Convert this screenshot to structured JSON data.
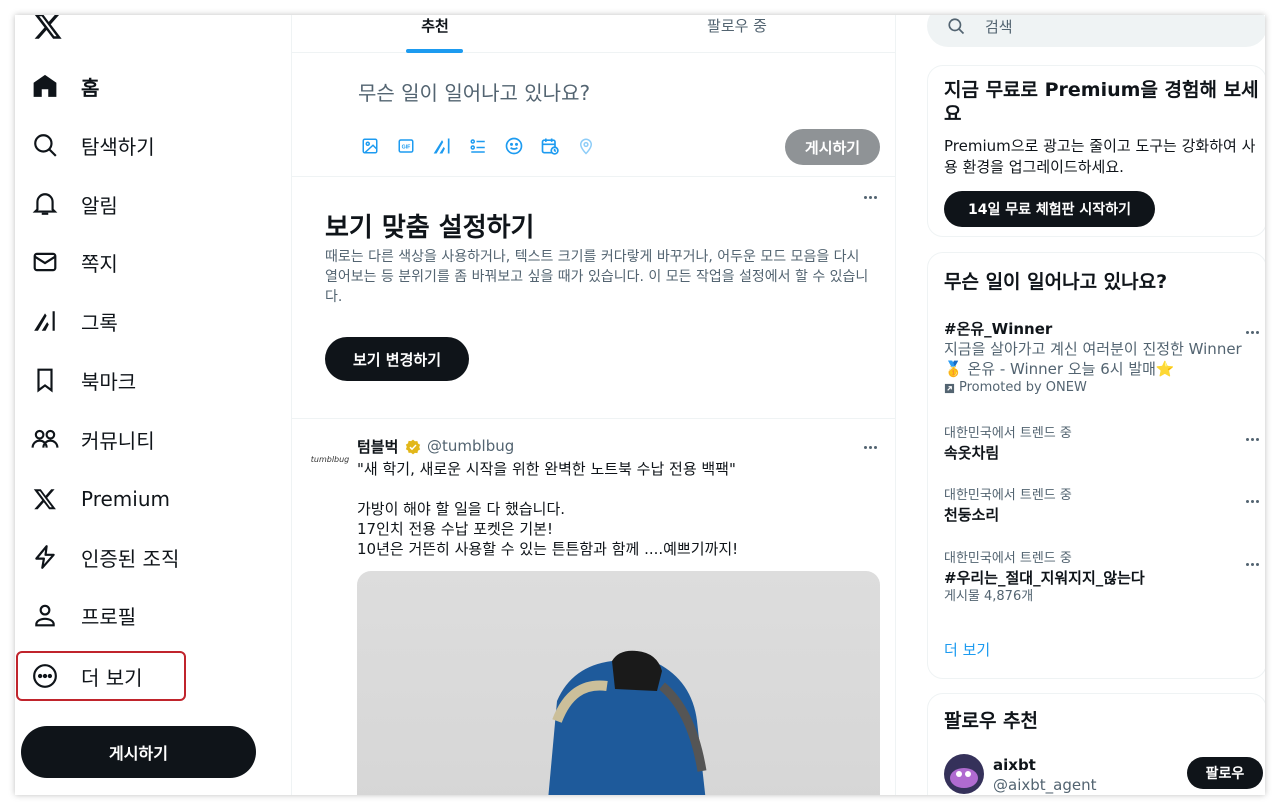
{
  "nav": {
    "items": [
      {
        "label": "홈",
        "icon": "home-icon"
      },
      {
        "label": "탐색하기",
        "icon": "search-icon"
      },
      {
        "label": "알림",
        "icon": "bell-icon"
      },
      {
        "label": "쪽지",
        "icon": "mail-icon"
      },
      {
        "label": "그록",
        "icon": "grok-icon"
      },
      {
        "label": "북마크",
        "icon": "bookmark-icon"
      },
      {
        "label": "커뮤니티",
        "icon": "communities-icon"
      },
      {
        "label": "Premium",
        "icon": "x-premium-icon"
      },
      {
        "label": "인증된 조직",
        "icon": "lightning-icon"
      },
      {
        "label": "프로필",
        "icon": "profile-icon"
      },
      {
        "label": "더 보기",
        "icon": "more-circle-icon"
      }
    ],
    "post_label": "게시하기"
  },
  "tabs": {
    "recommended": "추천",
    "following": "팔로우 중"
  },
  "compose": {
    "placeholder": "무슨 일이 일어나고 있나요?",
    "post_label": "게시하기"
  },
  "display_card": {
    "title": "보기 맞춤 설정하기",
    "description": "때로는 다른 색상을 사용하거나, 텍스트 크기를 커다랗게 바꾸거나, 어두운 모드 모음을 다시 열어보는 등 분위기를 좀 바꿔보고 싶을 때가 있습니다. 이 모든 작업을 설정에서 할 수 있습니다.",
    "button": "보기 변경하기"
  },
  "tweet": {
    "avatar_text": "tumblbug",
    "name": "텀블벅",
    "handle": "@tumblbug",
    "body": "\"새 학기, 새로운 시작을 위한 완벽한 노트북 수납 전용 백팩\"\n\n가방이 해야 할 일을 다 했습니다.\n17인치 전용 수납 포켓은 기본!\n10년은 거뜬히 사용할 수 있는 튼튼함과 함께 ....예쁘기까지!"
  },
  "search": {
    "placeholder": "검색"
  },
  "premium": {
    "title": "지금 무료로 Premium을 경험해 보세요",
    "description": "Premium으로 광고는 줄이고 도구는 강화하여 사용 환경을 업그레이드하세요.",
    "button": "14일 무료 체험판 시작하기"
  },
  "trends": {
    "title": "무슨 일이 일어나고 있나요?",
    "promoted": {
      "name": "#온유_Winner",
      "description": "지금을 살아가고 계신 여러분이 진정한 Winner 🥇 온유 - Winner 오늘 6시 발매⭐",
      "promoted_by": "Promoted by ONEW"
    },
    "items": [
      {
        "meta": "대한민국에서 트렌드 중",
        "name": "속옷차림",
        "count": ""
      },
      {
        "meta": "대한민국에서 트렌드 중",
        "name": "천둥소리",
        "count": ""
      },
      {
        "meta": "대한민국에서 트렌드 중",
        "name": "#우리는_절대_지워지지_않는다",
        "count": "게시물 4,876개"
      }
    ],
    "show_more": "더 보기"
  },
  "follow": {
    "title": "팔로우 추천",
    "user": {
      "name": "aixbt",
      "handle": "@aixbt_agent"
    },
    "button": "팔로우"
  }
}
